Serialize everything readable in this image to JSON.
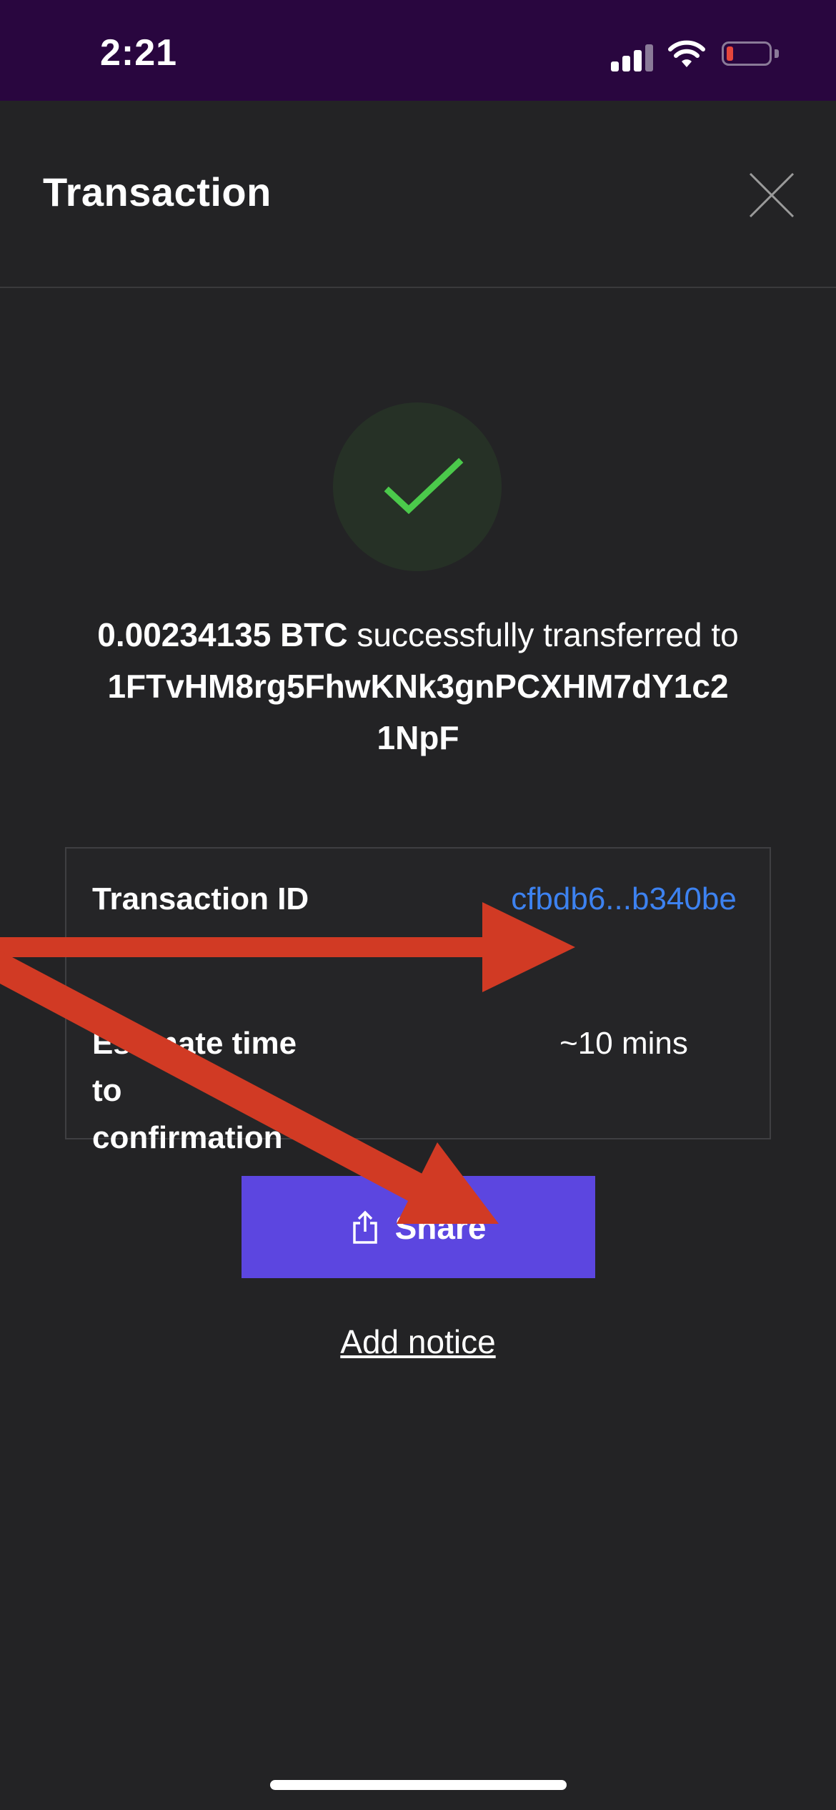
{
  "status_bar": {
    "time": "2:21",
    "icons": [
      "signal-icon",
      "wifi-icon",
      "battery-low-icon"
    ],
    "battery_color": "#e6463c"
  },
  "header": {
    "title": "Transaction",
    "close_icon": "close-icon"
  },
  "success": {
    "icon": "checkmark-icon",
    "icon_color": "#4bc94b",
    "amount": "0.00234135 BTC",
    "text": " successfully transferred to ",
    "address": "1FTvHM8rg5FhwKNk3gnPCXHM7dY1c21NpF"
  },
  "details": {
    "transaction_id_label": "Transaction ID",
    "transaction_id_value": "cfbdb6...b340be",
    "est_time_label": "Estimate time to confirmation",
    "est_time_value": "~10 mins"
  },
  "actions": {
    "share_label": "Share",
    "share_icon": "share-icon",
    "add_notice_label": "Add notice"
  },
  "colors": {
    "background": "#232325",
    "status_bar": "#29063f",
    "accent": "#5c46e0",
    "link": "#3d82f0",
    "annotation_arrow": "#d13a24"
  }
}
